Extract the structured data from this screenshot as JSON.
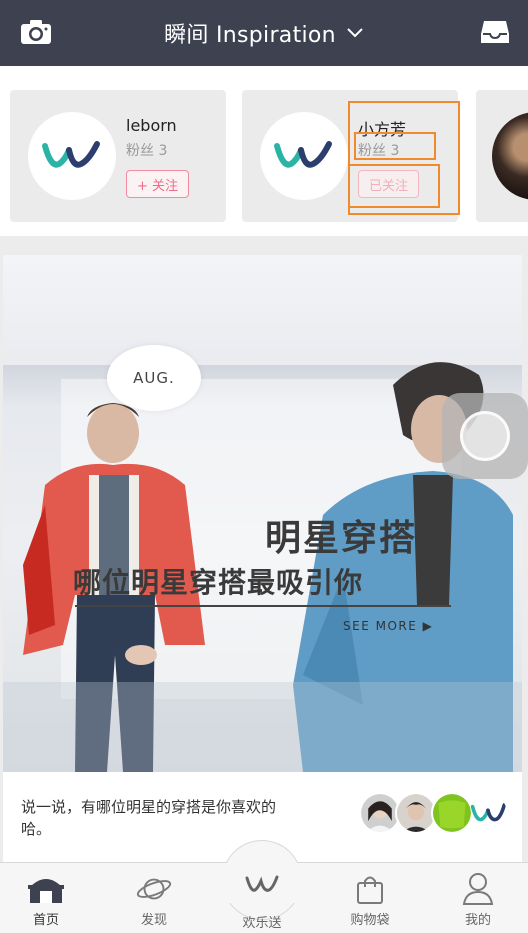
{
  "header": {
    "title": "瞬间 Inspiration",
    "camera_icon": "camera-icon",
    "inbox_icon": "inbox-icon",
    "dropdown_icon": "chevron-down-icon"
  },
  "users": [
    {
      "name": "leborn",
      "fans": "粉丝 3",
      "follow_label": "+ 关注",
      "followed": false
    },
    {
      "name": "小方芳",
      "fans": "粉丝 3",
      "follow_label": "已关注",
      "followed": true
    }
  ],
  "banner": {
    "badge": "AUG.",
    "headline": "明星穿搭",
    "subline": "哪位明星穿搭最吸引你",
    "see_more": "SEE MORE ▶"
  },
  "post": {
    "caption": "说一说，有哪位明星的穿搭是你喜欢的哈。"
  },
  "tabs": [
    {
      "label": "首页",
      "icon": "home-icon",
      "active": true
    },
    {
      "label": "发现",
      "icon": "planet-icon",
      "active": false
    },
    {
      "label": "欢乐送",
      "icon": "w-logo-icon",
      "active": false
    },
    {
      "label": "购物袋",
      "icon": "shopping-bag-icon",
      "active": false
    },
    {
      "label": "我的",
      "icon": "person-icon",
      "active": false
    }
  ],
  "colors": {
    "header_bg": "#3d4150",
    "follow_accent": "#ef6b86",
    "highlight": "#f08a2c",
    "logo_teal": "#2bb3a6",
    "logo_navy": "#2b3e6e"
  }
}
